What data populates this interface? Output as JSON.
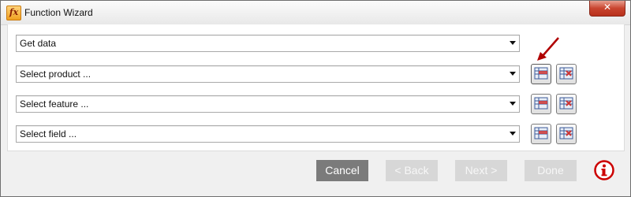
{
  "window": {
    "title": "Function Wizard",
    "app_icon_text": "fx",
    "close_glyph": "✕"
  },
  "rows": [
    {
      "label": "Get data",
      "has_buttons": false
    },
    {
      "label": "Select product ...",
      "has_buttons": true
    },
    {
      "label": "Select feature ...",
      "has_buttons": true
    },
    {
      "label": "Select field ...",
      "has_buttons": true
    }
  ],
  "row_button_icons": [
    "insert-row-icon",
    "delete-row-icon"
  ],
  "footer": {
    "cancel_label": "Cancel",
    "back_label": "< Back",
    "next_label": "Next >",
    "done_label": "Done"
  },
  "info_icon": "info-circle-icon",
  "colors": {
    "accent_red": "#cc0000",
    "button_active": "#7b7b7b",
    "button_disabled": "#d7d7d7"
  }
}
